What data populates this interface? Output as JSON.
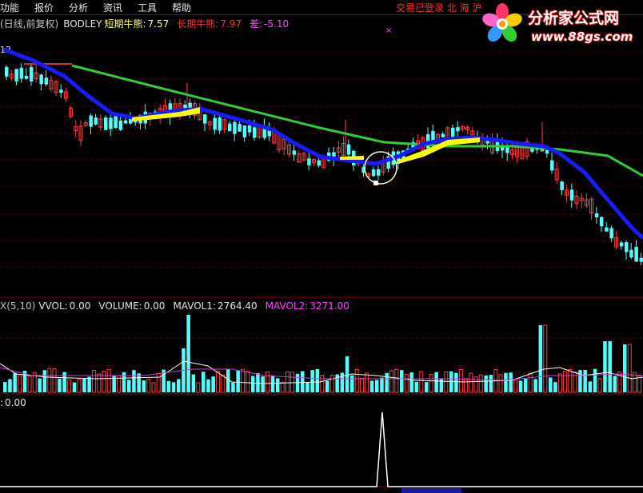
{
  "menu": {
    "items": [
      "功能",
      "报价",
      "分析",
      "资讯",
      "工具",
      "帮助"
    ],
    "status": "交易已登录 北 海 沪"
  },
  "logo": {
    "brand": "分析家公式网",
    "site": "www.88gs.com"
  },
  "main_panel": {
    "label_prefix": "(日线,前复权)",
    "indicator_name": "BODLEY",
    "short_label": "短期牛熊:",
    "short_value": "7.57",
    "long_label": "长期牛熊:",
    "long_value": "7.97",
    "diff_label": "差:",
    "diff_value": "-5.10",
    "axis_tick": "12",
    "marker": "×"
  },
  "volume_panel": {
    "prefix": "X(5,10)",
    "vvol_label": "VVOL:",
    "vvol_value": "0.00",
    "volume_label": "VOLUME:",
    "volume_value": "0.00",
    "mavol1_label": "MAVOL1:",
    "mavol1_value": "2764.40",
    "mavol2_label": "MAVOL2:",
    "mavol2_value": "3271.00"
  },
  "signal_panel": {
    "label": ":",
    "value": "0.00"
  },
  "colors": {
    "up": "#ff4040",
    "down": "#54ffff",
    "short_line": "#1a1aff",
    "long_line": "#33cc33",
    "mavol1": "#ffffff",
    "mavol2": "#cc44cc",
    "signal": "#ffffff",
    "band": "#ffff00",
    "grid": "#8b0000"
  }
}
